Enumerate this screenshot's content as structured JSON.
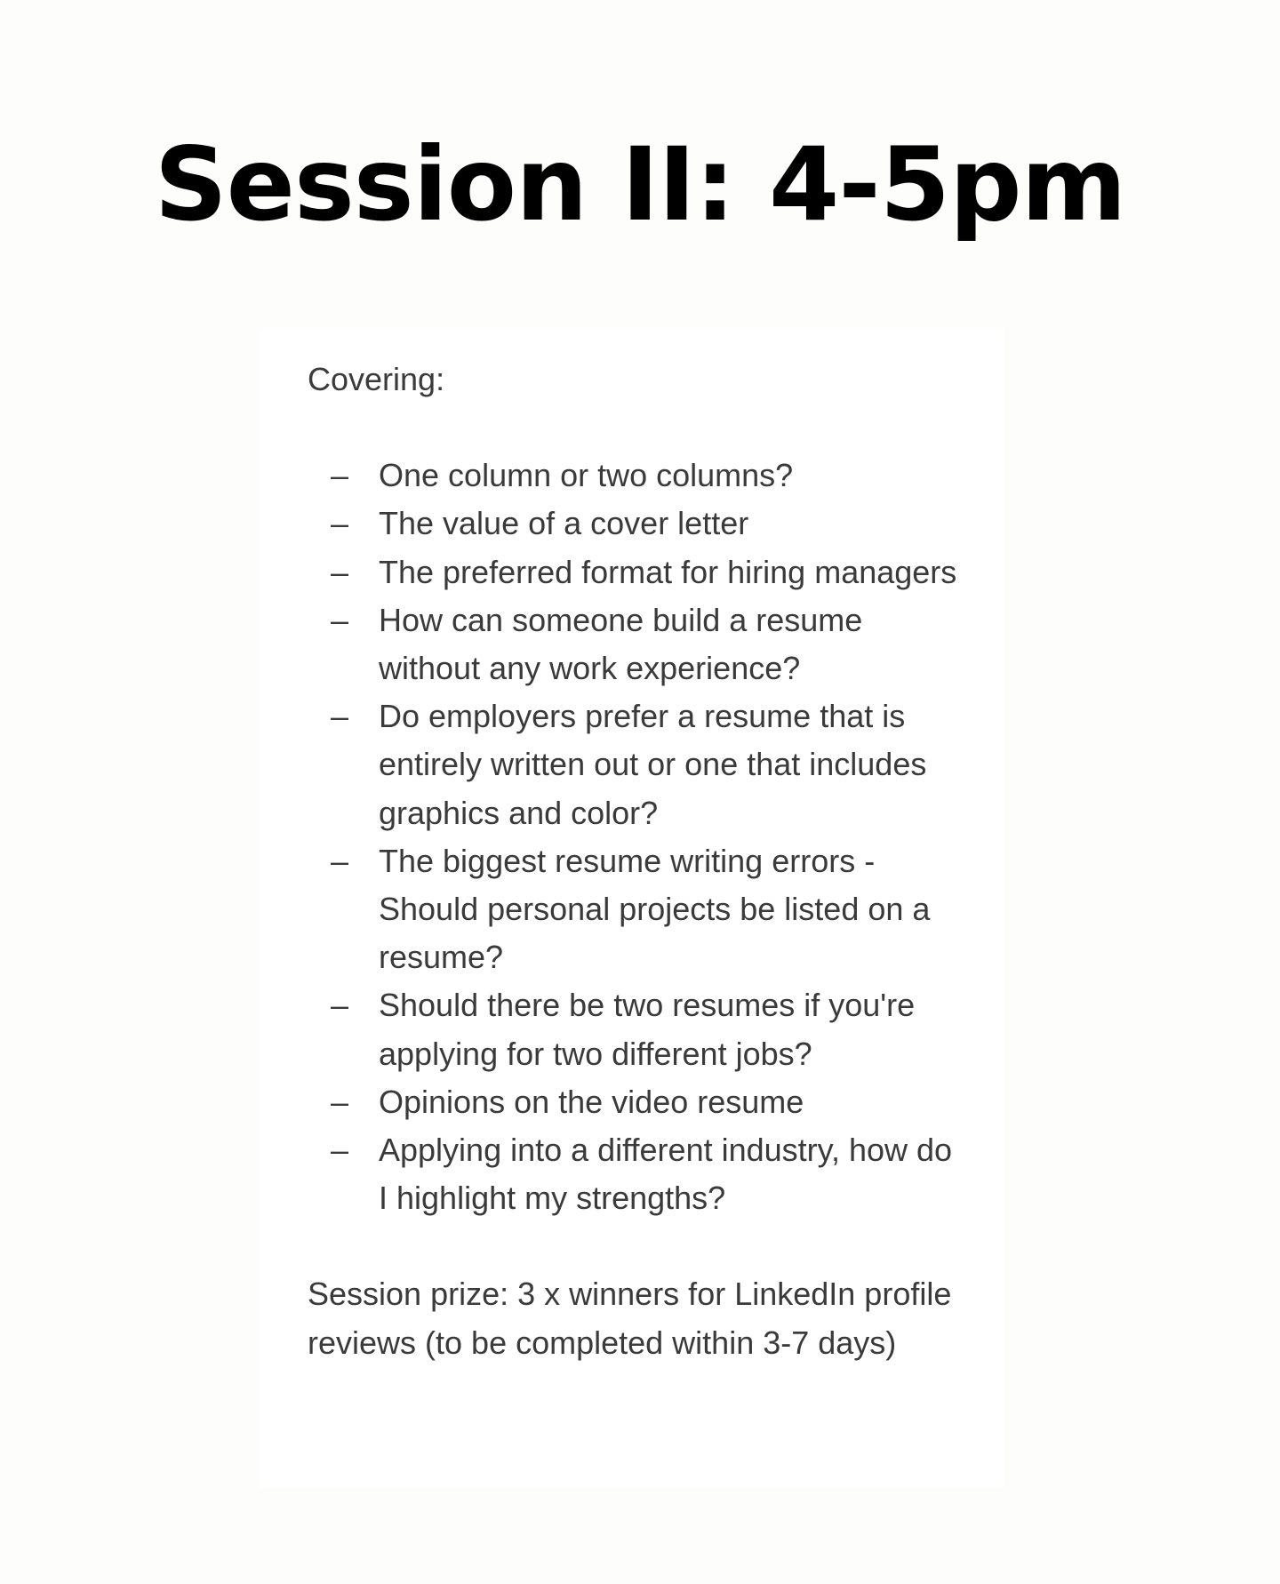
{
  "title": "Session  II: 4-5pm",
  "card": {
    "intro": "Covering:",
    "bullet": "–",
    "items": [
      "One column or two columns?",
      "The value of a cover letter",
      "The preferred format for hiring managers",
      "How can someone build a resume without any work experience?",
      "Do employers prefer a resume that is entirely written out or one that includes graphics and color?",
      "The biggest resume writing errors - Should personal projects be listed on a resume?",
      "Should there be two resumes if you're applying for two different jobs?",
      "Opinions on the video resume",
      "Applying into a different industry, how do I highlight my strengths?"
    ],
    "prize": "Session prize: 3 x winners for LinkedIn profile reviews (to be completed within 3-7 days)"
  }
}
